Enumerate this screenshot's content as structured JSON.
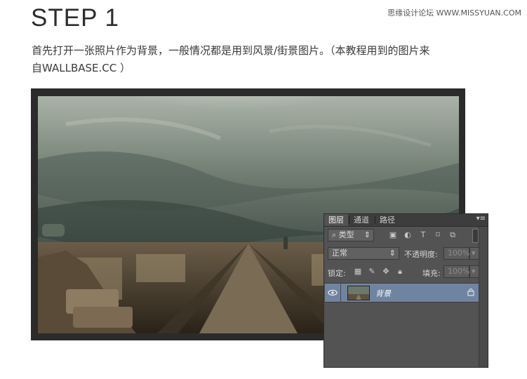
{
  "header": {
    "watermark": "思缘设计论坛 WWW.MISSYUAN.COM",
    "step_title": "STEP 1",
    "description_line1": "首先打开一张照片作为背景，一般情况都是用到风景/街景图片。（本教程用到的图片来",
    "description_line2": "自WALLBASE.CC ）"
  },
  "layers_panel": {
    "tabs": [
      {
        "label": "图层",
        "active": true
      },
      {
        "label": "通道",
        "active": false
      },
      {
        "label": "路径",
        "active": false
      }
    ],
    "menu_icon": "panel-menu-icon",
    "filter_label": "类型",
    "filter_icons": [
      "image-filter-icon",
      "adjustment-filter-icon",
      "type-filter-icon",
      "shape-filter-icon",
      "smartobject-filter-icon"
    ],
    "blend_mode": "正常",
    "opacity_label": "不透明度:",
    "opacity_value": "100%",
    "lock_label": "锁定:",
    "fill_label": "填充:",
    "fill_value": "100%",
    "layers": [
      {
        "name": "背景",
        "visible": true,
        "locked": true,
        "selected": true
      }
    ]
  },
  "colors": {
    "panel_bg": "#535353",
    "selected_row": "#6f84a1",
    "frame": "#2b2b2b"
  }
}
